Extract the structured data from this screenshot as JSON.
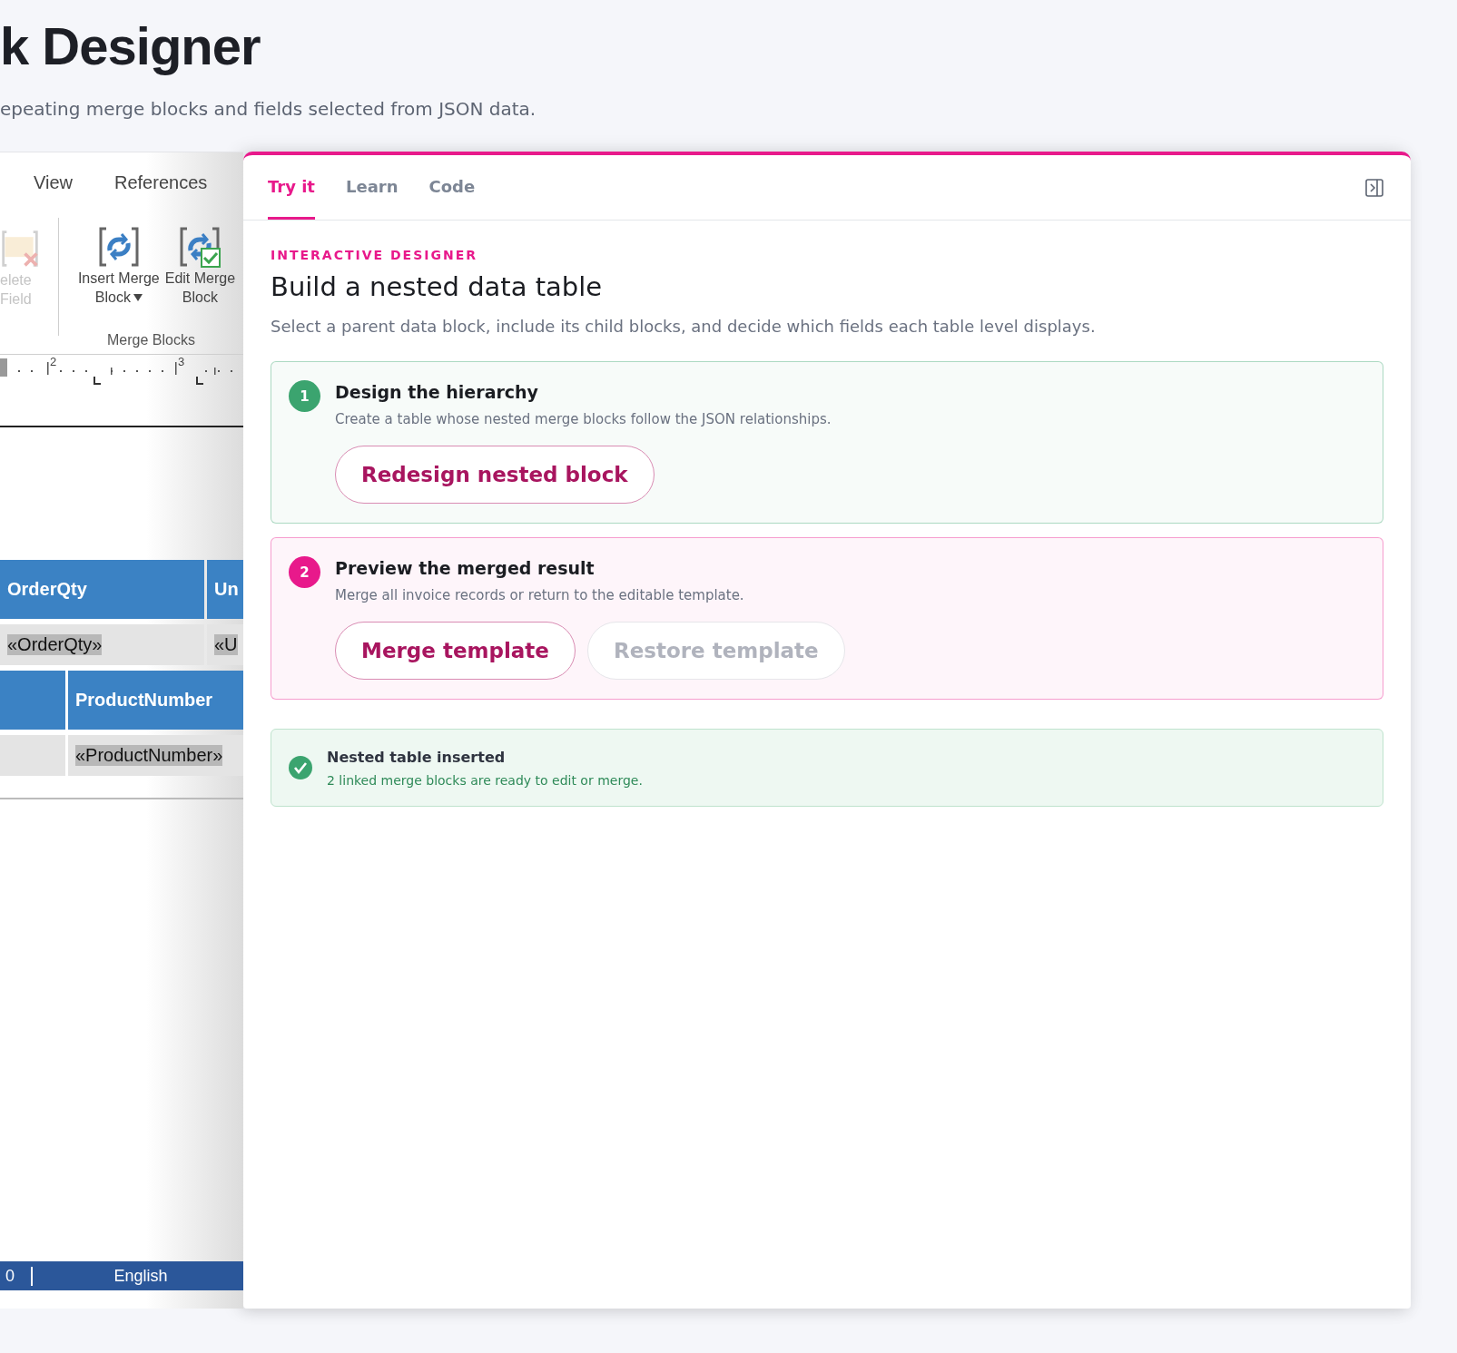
{
  "header": {
    "title": "k Designer",
    "subtitle": "epeating merge blocks and fields selected from JSON data."
  },
  "editor": {
    "ribbon_tabs": [
      "View",
      "References"
    ],
    "ribbon_buttons": [
      {
        "kind": "delete",
        "lines": [
          "elete",
          "Field"
        ],
        "disabled": true,
        "dropdown": false
      },
      {
        "kind": "insert",
        "lines": [
          "Insert Merge",
          "Block"
        ],
        "disabled": false,
        "dropdown": true
      },
      {
        "kind": "edit",
        "lines": [
          "Edit Merge",
          "Block"
        ],
        "disabled": false,
        "dropdown": false
      }
    ],
    "ribbon_group": "Merge Blocks",
    "ruler": [
      "2",
      "3"
    ],
    "tables": [
      {
        "columns": [
          {
            "header": "OrderQty",
            "field": "«OrderQty»"
          },
          {
            "header": "Un",
            "field": "«U"
          }
        ]
      },
      {
        "columns": [
          {},
          {
            "header": "ProductNumber",
            "field": "«ProductNumber»"
          }
        ]
      }
    ],
    "status_bar": [
      "0",
      "English"
    ]
  },
  "panel": {
    "tabs": [
      {
        "label": "Try it",
        "selected": true
      },
      {
        "label": "Learn",
        "selected": false
      },
      {
        "label": "Code",
        "selected": false
      }
    ],
    "eyebrow": "INTERACTIVE DESIGNER",
    "title": "Build a nested data table",
    "description": "Select a parent data block, include its child blocks, and decide which fields each table level displays.",
    "steps": [
      {
        "number": "1",
        "color": "#3ba46f",
        "title": "Design the hierarchy",
        "description": "Create a table whose nested merge blocks follow the JSON relationships.",
        "buttons": [
          {
            "label": "Redesign nested block",
            "disabled": false
          }
        ]
      },
      {
        "number": "2",
        "color": "#e8198b",
        "title": "Preview the merged result",
        "description": "Merge all invoice records or return to the editable template.",
        "buttons": [
          {
            "label": "Merge template",
            "disabled": false
          },
          {
            "label": "Restore template",
            "disabled": true
          }
        ]
      }
    ],
    "notice": {
      "title": "Nested table inserted",
      "message": "2 linked merge blocks are ready to edit or merge."
    }
  }
}
